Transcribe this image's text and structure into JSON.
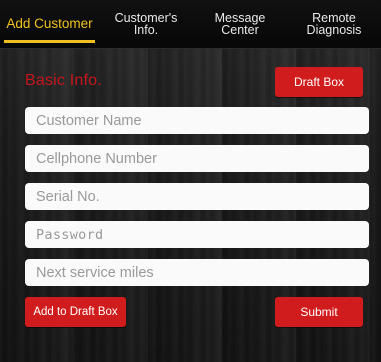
{
  "tabs": [
    {
      "label": "Add Customer",
      "active": true
    },
    {
      "label": "Customer's\nInfo.",
      "active": false
    },
    {
      "label": "Message\nCenter",
      "active": false
    },
    {
      "label": "Remote\nDiagnosis",
      "active": false
    }
  ],
  "form": {
    "section_title": "Basic Info.",
    "draft_box_label": "Draft Box",
    "fields": [
      {
        "placeholder": "Customer Name",
        "value": ""
      },
      {
        "placeholder": "Cellphone Number",
        "value": ""
      },
      {
        "placeholder": "Serial No.",
        "value": ""
      },
      {
        "placeholder": "Password",
        "value": ""
      },
      {
        "placeholder": "Next service miles",
        "value": ""
      }
    ],
    "add_to_draft_label": "Add to Draft Box",
    "submit_label": "Submit"
  },
  "colors": {
    "accent_tab": "#f0c023",
    "button_red": "#d01c1c",
    "title_red": "#c4161c"
  }
}
